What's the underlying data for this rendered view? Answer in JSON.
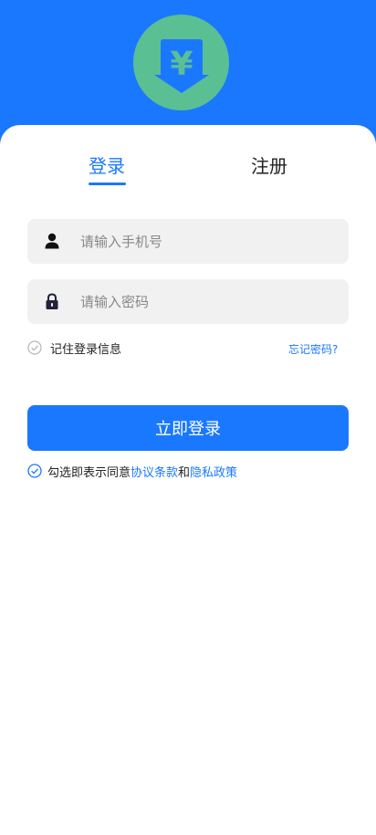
{
  "colors": {
    "primary": "#1a78ff",
    "logo_green": "#5bbf94",
    "field_bg": "#f1f1f1",
    "text_dark": "#222222",
    "placeholder": "#888888"
  },
  "header": {
    "logo_icon": "yen-download-icon",
    "logo_symbol": "¥"
  },
  "tabs": [
    {
      "label": "登录",
      "active": true
    },
    {
      "label": "注册",
      "active": false
    }
  ],
  "form": {
    "phone": {
      "placeholder": "请输入手机号",
      "value": "",
      "icon": "user-icon"
    },
    "password": {
      "placeholder": "请输入密码",
      "value": "",
      "icon": "lock-icon"
    },
    "remember_label": "记住登录信息",
    "remember_checked": false,
    "forgot_label": "忘记密码?",
    "submit_label": "立即登录"
  },
  "agreement": {
    "checked": true,
    "prefix": "勾选即表示同意",
    "terms_label": "协议条款",
    "conjunction": "和",
    "privacy_label": "隐私政策"
  }
}
